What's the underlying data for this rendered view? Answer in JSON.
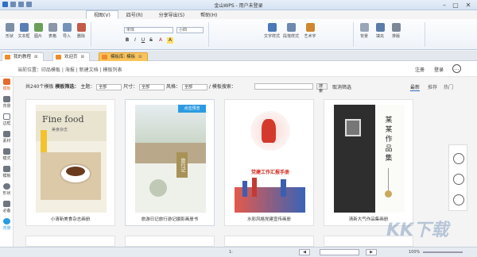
{
  "window": {
    "title": "金山WPS - 用户未登录",
    "min": "–",
    "max": "▢",
    "close": "✕"
  },
  "menu_tabs": [
    "视图(V)",
    "四号(R)",
    "分享导出(S)",
    "帮助(H)"
  ],
  "ribbon": {
    "buttons": [
      "形状",
      "文本框",
      "图片",
      "表格",
      "导入",
      "删除"
    ],
    "font_name": "宋体",
    "font_size": "小四",
    "format_buttons": [
      "B",
      "I",
      "U",
      "S",
      "A",
      "A"
    ],
    "right_buttons": [
      "文字样式",
      "段落样式",
      "艺术字",
      "背景",
      "填充",
      "排版"
    ]
  },
  "doc_tabs": [
    {
      "label": "我的教程",
      "active": false
    },
    {
      "label": "欢迎页",
      "active": false
    },
    {
      "label": "模板库: 模板",
      "active": true
    }
  ],
  "header": {
    "breadcrumb": "当前位置：印品模板 | 海报 | 新建文档 | 模板列表",
    "login": "注册",
    "register": "登录"
  },
  "sidebar": [
    "模板",
    "背景",
    "边框",
    "素材",
    "模式",
    "模板",
    "形状",
    "必备",
    "背景"
  ],
  "toolbar": {
    "count": "共240个模板",
    "filter_label": "模板筛选：",
    "topic_label": "主题：",
    "topic_value": "全部",
    "size_label": "尺寸：",
    "size_value": "全部",
    "style_label": "风格：",
    "style_value": "全部",
    "search_label": "/ 模板搜索：",
    "search_button": "搜索",
    "cancel_filter": "取消筛选",
    "sort": [
      "最新",
      "推荐",
      "热门"
    ]
  },
  "cards": [
    {
      "caption": "小清新美食杂志画册",
      "cover_title": "Fine food",
      "cover_sub": "美食杂志"
    },
    {
      "caption": "旅游日记旅行游记摄影画册书",
      "cover_title": "旅行记",
      "badge": "点击预览"
    },
    {
      "caption": "水彩风格党建宣传画册",
      "cover_title": "党建工作汇报手册"
    },
    {
      "caption": "清新大气作品集画册",
      "cover_title": "某某作品集"
    }
  ],
  "statusbar": {
    "page": "1:",
    "zoom": "100%"
  },
  "watermark": "KK下载",
  "colors": {
    "accent": "#2b6cc4",
    "active_tab": "#f9c45a",
    "badge": "#2b9be0"
  }
}
